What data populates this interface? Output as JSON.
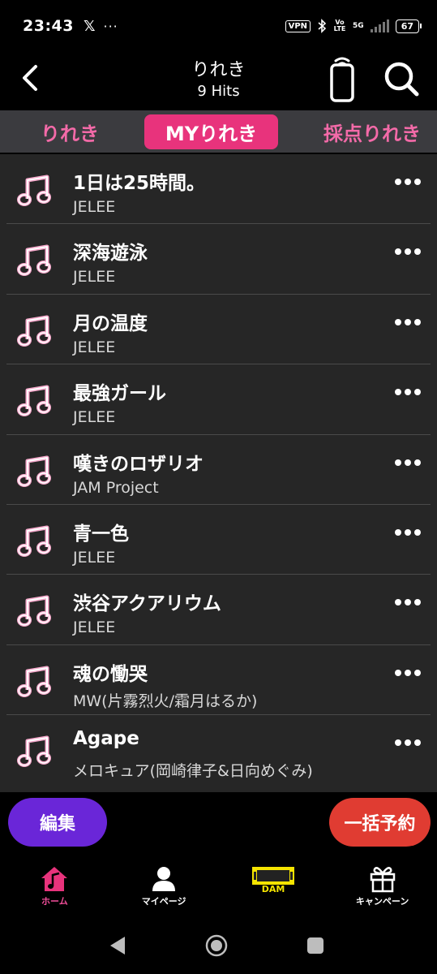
{
  "status_bar": {
    "time": "23:43",
    "app_icon": "x-logo",
    "x_label": "𝕏",
    "dots": "···",
    "vpn": "VPN",
    "volte": "Vo LTE",
    "network": "5G",
    "battery": "67"
  },
  "header": {
    "title": "りれき",
    "subtitle": "9 Hits"
  },
  "tabs": [
    {
      "label": "りれき",
      "active": false
    },
    {
      "label": "MYりれき",
      "active": true
    },
    {
      "label": "採点りれき",
      "active": false
    }
  ],
  "songs": [
    {
      "title": "1日は25時間。",
      "artist": "JELEE"
    },
    {
      "title": "深海遊泳",
      "artist": "JELEE"
    },
    {
      "title": "月の温度",
      "artist": "JELEE"
    },
    {
      "title": "最強ガール",
      "artist": "JELEE"
    },
    {
      "title": "嘆きのロザリオ",
      "artist": "JAM Project"
    },
    {
      "title": "青一色",
      "artist": "JELEE"
    },
    {
      "title": "渋谷アクアリウム",
      "artist": "JELEE"
    },
    {
      "title": "魂の慟哭",
      "artist": "MW(片霧烈火/霜月はるか)"
    },
    {
      "title": "Agape",
      "artist": "メロキュア(岡崎律子&日向めぐみ)"
    }
  ],
  "actions": {
    "edit": "編集",
    "reserve_all": "一括予約"
  },
  "bottom_nav": [
    {
      "label": "ホーム",
      "icon": "home-music-icon",
      "active": true
    },
    {
      "label": "マイページ",
      "icon": "person-icon",
      "active": false
    },
    {
      "label": "DAM",
      "icon": "dam-logo-icon",
      "active": false
    },
    {
      "label": "キャンペーン",
      "icon": "gift-icon",
      "active": false
    }
  ],
  "colors": {
    "accent_pink": "#e8337c",
    "tab_pink": "#f36aa8",
    "edit_purple": "#6a26d8",
    "reserve_red": "#e03c32",
    "dam_yellow": "#f5e400"
  }
}
